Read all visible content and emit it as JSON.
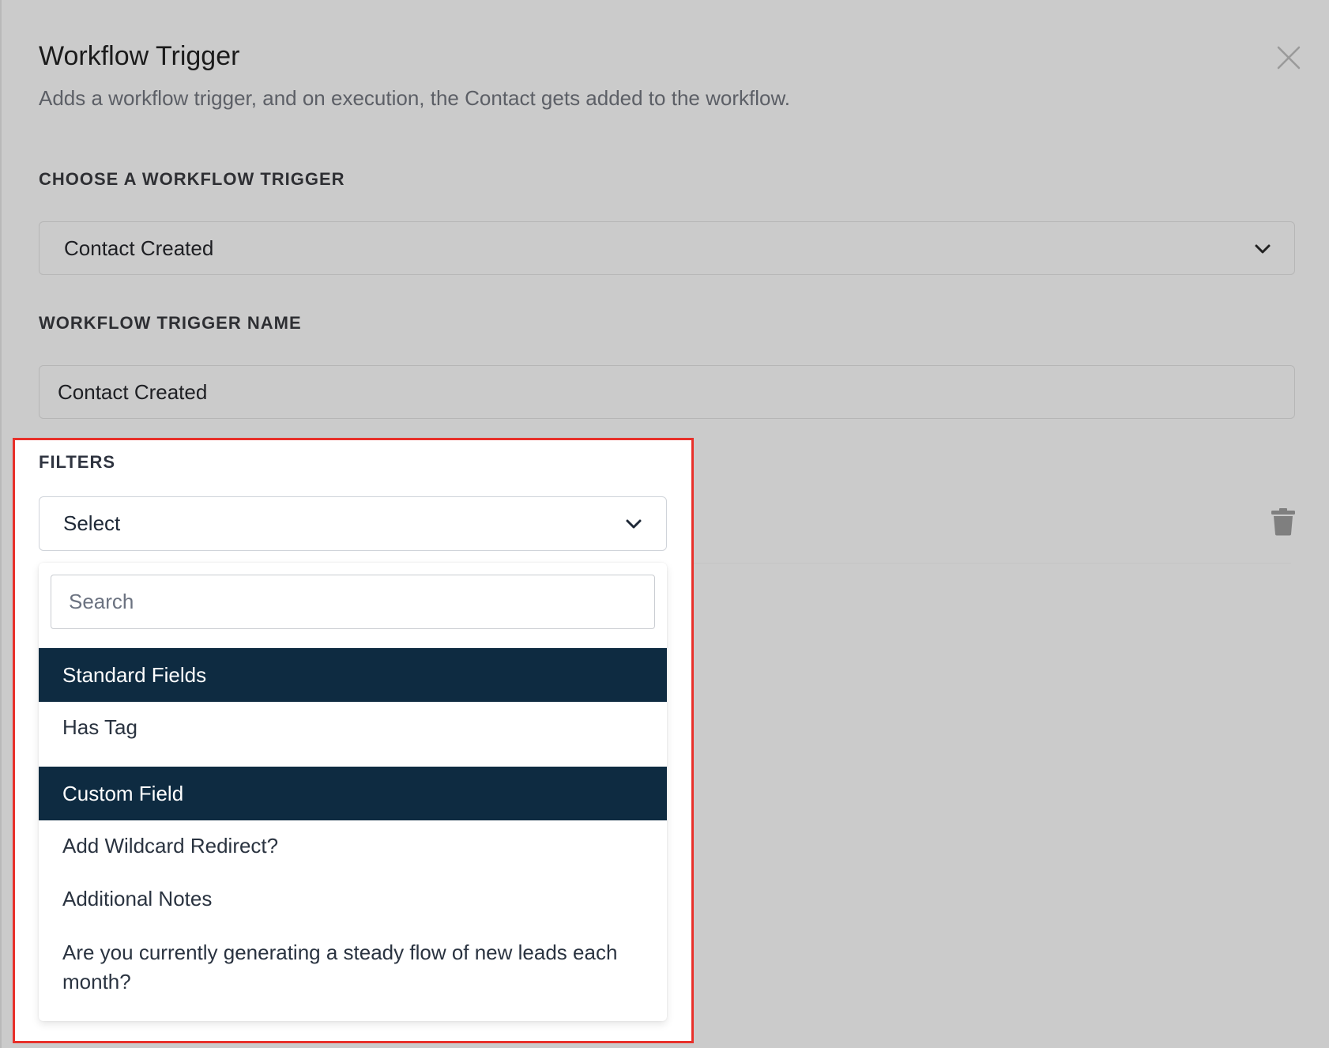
{
  "dialog": {
    "title": "Workflow Trigger",
    "subtitle": "Adds a workflow trigger, and on execution, the Contact gets added to the workflow."
  },
  "trigger_select": {
    "label": "CHOOSE A WORKFLOW TRIGGER",
    "value": "Contact Created"
  },
  "trigger_name": {
    "label": "WORKFLOW TRIGGER NAME",
    "value": "Contact Created"
  },
  "filters": {
    "label": "FILTERS",
    "select_value": "Select",
    "search_placeholder": "Search",
    "groups": [
      {
        "header": "Standard Fields",
        "options": [
          "Has Tag"
        ]
      },
      {
        "header": "Custom Field",
        "options": [
          "Add Wildcard Redirect?",
          "Additional Notes",
          "Are you currently generating a steady flow of new leads each month?"
        ]
      }
    ]
  },
  "icons": {
    "close": "close-icon",
    "chevron": "chevron-down-icon",
    "trash": "trash-icon"
  },
  "colors": {
    "overlay_background": "#cbcbcb",
    "group_header_bg": "#0e2b41",
    "highlight_border": "#e8302a"
  }
}
